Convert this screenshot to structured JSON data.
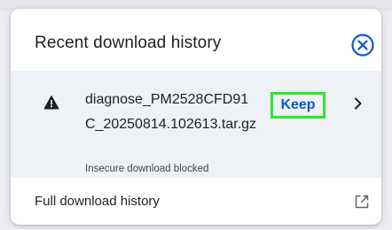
{
  "panel": {
    "title": "Recent download history",
    "close_icon": "close-circle-icon"
  },
  "download_item": {
    "warning_icon": "warning-triangle-icon",
    "filename": "diagnose_PM2528CFD91C_20250814.102613.tar.gz",
    "status": "Insecure download blocked",
    "keep_label": "Keep",
    "chevron_icon": "chevron-right-icon"
  },
  "footer": {
    "label": "Full download history",
    "open_icon": "open-in-new-icon"
  },
  "colors": {
    "accent_blue": "#0b57d0",
    "highlight_green": "#2ee52e",
    "item_background": "#eef1f6",
    "text_primary": "#1f1f1f",
    "text_secondary": "#444746"
  }
}
